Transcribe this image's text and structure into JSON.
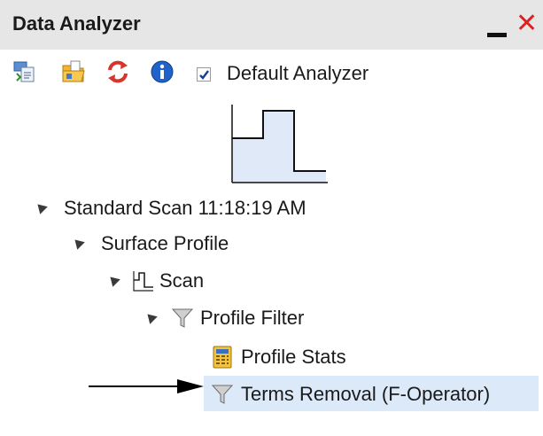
{
  "window": {
    "title": "Data Analyzer"
  },
  "titlebar_buttons": {
    "minimize": "minimize-icon",
    "close": "close-icon",
    "close_color": "#e02020"
  },
  "toolbar": {
    "icons": [
      "export-icon",
      "open-folder-icon",
      "refresh-icon",
      "info-icon"
    ],
    "default_analyzer": {
      "label": "Default Analyzer",
      "checked": true
    }
  },
  "preview": {
    "icon": "step-profile-preview-icon"
  },
  "tree": {
    "standard_scan": {
      "label": "Standard Scan 11:18:19 AM",
      "expanded": true
    },
    "surface_profile": {
      "label": "Surface Profile",
      "expanded": true
    },
    "scan": {
      "label": "Scan",
      "icon": "scan-profile-icon",
      "expanded": true
    },
    "profile_filter": {
      "label": "Profile Filter",
      "icon": "filter-funnel-icon",
      "expanded": true
    },
    "profile_stats": {
      "label": "Profile Stats",
      "icon": "calculator-icon"
    },
    "terms_removal": {
      "label": "Terms Removal (F-Operator)",
      "icon": "filter-funnel-icon",
      "selected": true
    }
  },
  "colors": {
    "selection": "#dbe9f8",
    "titlebar": "#e6e6e6"
  }
}
